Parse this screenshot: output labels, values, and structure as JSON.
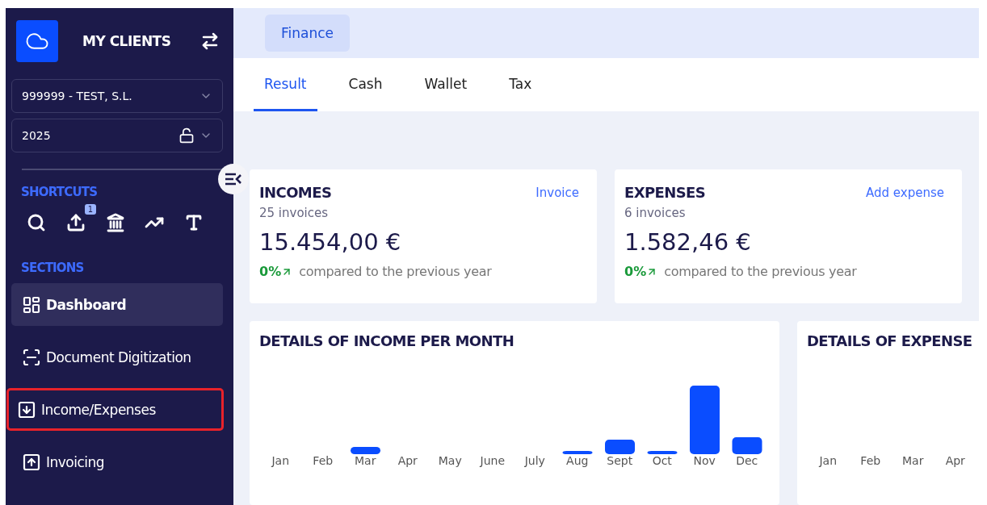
{
  "sidebar": {
    "brand": "MY CLIENTS",
    "company_select": {
      "value": "999999 - TEST, S.L."
    },
    "year_select": {
      "value": "2025"
    },
    "shortcuts_heading": "SHORTCUTS",
    "upload_badge": "1",
    "sections_heading": "SECTIONS",
    "items": [
      {
        "label": "Dashboard",
        "selected": true,
        "highlighted": false
      },
      {
        "label": "Document Digitization",
        "selected": false,
        "highlighted": false
      },
      {
        "label": "Income/Expenses",
        "selected": false,
        "highlighted": true
      },
      {
        "label": "Invoicing",
        "selected": false,
        "highlighted": false
      }
    ]
  },
  "top_tabs": [
    {
      "label": "Finance",
      "selected": true
    }
  ],
  "tabs": [
    {
      "label": "Result",
      "selected": true
    },
    {
      "label": "Cash",
      "selected": false
    },
    {
      "label": "Wallet",
      "selected": false
    },
    {
      "label": "Tax",
      "selected": false
    }
  ],
  "cards": [
    {
      "title": "INCOMES",
      "link": "Invoice",
      "count": "25 invoices",
      "amount": "15.454,00 €",
      "change": "0%",
      "change_text": "compared to the previous year"
    },
    {
      "title": "EXPENSES",
      "link": "Add expense",
      "count": "6 invoices",
      "amount": "1.582,46 €",
      "change": "0%",
      "change_text": "compared to the previous year"
    }
  ],
  "charts": [
    {
      "title": "DETAILS OF INCOME PER MONTH",
      "months": [
        "Jan",
        "Feb",
        "Mar",
        "Apr",
        "May",
        "June",
        "July",
        "Aug",
        "Sept",
        "Oct",
        "Nov",
        "Dec"
      ],
      "kind": "bars"
    },
    {
      "title": "DETAILS OF EXPENSE",
      "months": [
        "Jan",
        "Feb",
        "Mar",
        "Apr"
      ],
      "kind": "empty"
    }
  ]
}
